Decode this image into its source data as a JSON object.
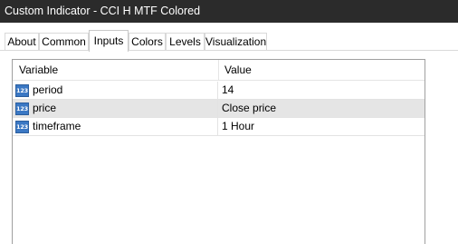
{
  "window": {
    "title": "Custom Indicator - CCI H MTF Colored"
  },
  "tabs": [
    {
      "label": "About",
      "active": false
    },
    {
      "label": "Common",
      "active": false
    },
    {
      "label": "Inputs",
      "active": true
    },
    {
      "label": "Colors",
      "active": false
    },
    {
      "label": "Levels",
      "active": false
    },
    {
      "label": "Visualization",
      "active": false
    }
  ],
  "inputs": {
    "columns": {
      "variable": "Variable",
      "value": "Value"
    },
    "rows": [
      {
        "name": "period",
        "value": "14",
        "icon": "numeric-123-icon",
        "icon_text": "123",
        "selected": false
      },
      {
        "name": "price",
        "value": "Close price",
        "icon": "numeric-123-icon",
        "icon_text": "123",
        "selected": true
      },
      {
        "name": "timeframe",
        "value": "1 Hour",
        "icon": "numeric-123-icon",
        "icon_text": "123",
        "selected": false
      }
    ]
  },
  "colors": {
    "titlebar": "#2b2b2b",
    "selected_row": "#e5e5e5",
    "icon_blue": "#3b78c4"
  }
}
